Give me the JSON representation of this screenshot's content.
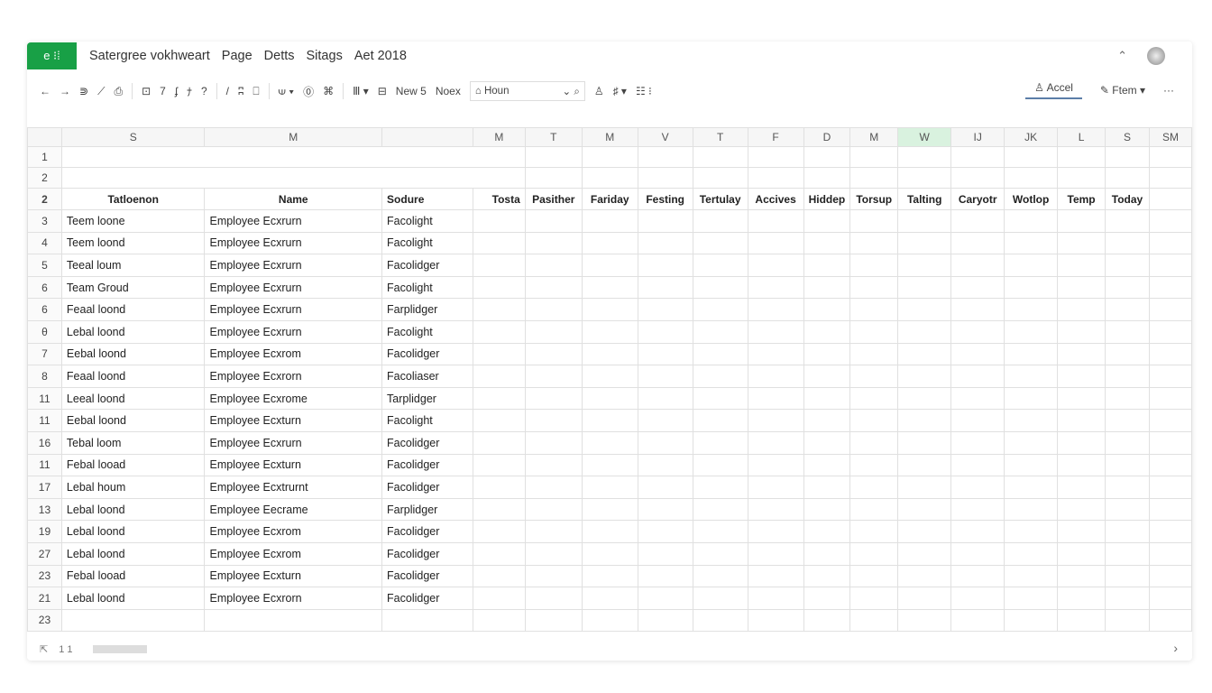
{
  "app": {
    "logo": "e ⁝⁞",
    "menu": [
      "Satergree vokhweart",
      "Page",
      "Detts",
      "Sitags",
      "Aet 2018"
    ],
    "collapse": "⌃"
  },
  "toolbar": {
    "icons": [
      "←",
      "→",
      "⋑",
      "⟋",
      "⎙",
      "⊡",
      "7",
      "ʄ",
      "ﾅ",
      "?",
      "/",
      "ʭ",
      "⎕",
      "⟒ ▾",
      "⓪",
      "⌘",
      "Ⅲ ▾",
      "⊟"
    ],
    "new_label": "New 5",
    "next_label": "Noex",
    "select_value": "⌂ Houn",
    "right_icons": [
      "♙",
      "♯ ▾",
      "☷ ⁝"
    ],
    "accel_label": "Accel",
    "form_label": "Ftem",
    "more": "···"
  },
  "columns": [
    "S",
    "M",
    "",
    "M",
    "T",
    "M",
    "V",
    "T",
    "F",
    "D",
    "M",
    "W",
    "IJ",
    "JK",
    "L",
    "S",
    "SM"
  ],
  "highlight_column": "W",
  "header_row": {
    "num": "2",
    "cells": [
      "Tatloenon",
      "Name",
      "Sodure",
      "Tosta",
      "Pasither",
      "Fariday",
      "Festing",
      "Tertulay",
      "Accives",
      "Hiddep",
      "Torsup",
      "Talting",
      "Caryotr",
      "Wotlop",
      "Temp",
      "Today",
      ""
    ]
  },
  "blank_rows": [
    "1",
    "2"
  ],
  "rows": [
    [
      "3",
      "Teem loone",
      "Employee Ecxrurn",
      "Facolight"
    ],
    [
      "4",
      "Teem loond",
      "Employee Ecxrurn",
      "Facolight"
    ],
    [
      "5",
      "Teeal loum",
      "Employee Ecxrurn",
      "Facolidger"
    ],
    [
      "6",
      "Team Groud",
      "Employee Ecxrurn",
      "Facolight"
    ],
    [
      "6",
      "Feaal loond",
      "Employee Ecxrurn",
      "Farplidger"
    ],
    [
      "θ",
      "Lebal loond",
      "Employee Ecxrurn",
      "Facolight"
    ],
    [
      "7",
      "Eebal loond",
      "Employee Ecxrom",
      "Facolidger"
    ],
    [
      "8",
      "Feaal loond",
      "Employee Ecxrorn",
      "Facoliaser"
    ],
    [
      "11",
      "Leeal loond",
      "Employee Ecxrome",
      "Tarplidger"
    ],
    [
      "11",
      "Eebal loond",
      "Employee Ecxturn",
      "Facolight"
    ],
    [
      "16",
      "Tebal loom",
      "Employee Ecxrurn",
      "Facolidger"
    ],
    [
      "11",
      "Febal looad",
      "Employee Ecxturn",
      "Facolidger"
    ],
    [
      "17",
      "Lebal houm",
      "Employee Ecxtrurnt",
      "Facolidger"
    ],
    [
      "13",
      "Lebal loond",
      "Employee Eecrame",
      "Farplidger"
    ],
    [
      "19",
      "Lebal loond",
      "Employee Ecxrom",
      "Facolidger"
    ],
    [
      "27",
      "Lebal loond",
      "Employee Ecxrom",
      "Facolidger"
    ],
    [
      "23",
      "Febal looad",
      "Employee Ecxturn",
      "Facolidger"
    ],
    [
      "21",
      "Lebal loond",
      "Employee Ecxrorn",
      "Facolidger"
    ]
  ],
  "last_row": "23",
  "footer": {
    "icon": "⇱",
    "sheet": "1 1",
    "next": "›"
  },
  "colors": {
    "brand": "#18a046",
    "highlight": "#d9f2df"
  }
}
